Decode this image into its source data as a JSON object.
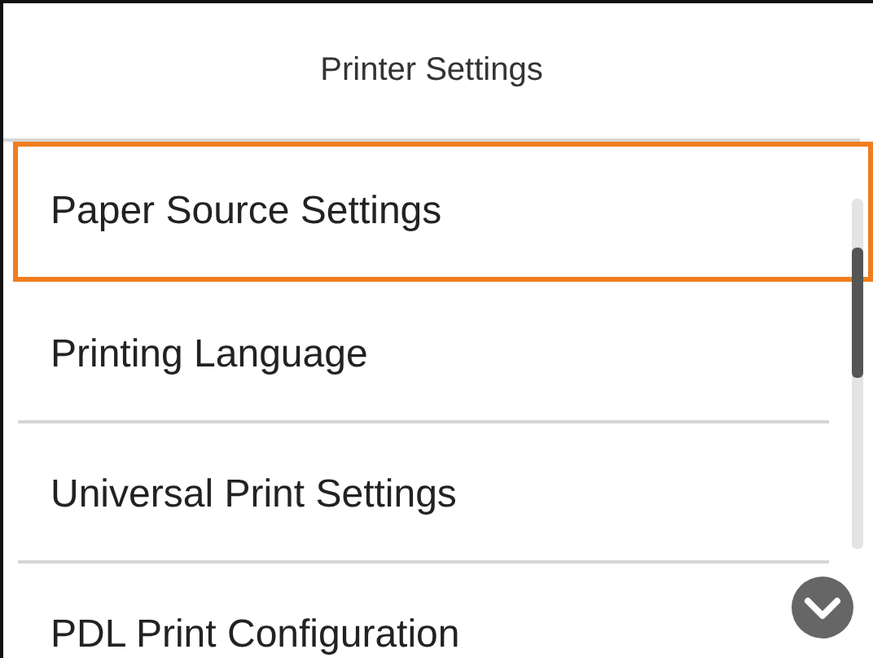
{
  "header": {
    "title": "Printer Settings"
  },
  "items": [
    {
      "label": "Paper Source Settings",
      "selected": true
    },
    {
      "label": "Printing Language",
      "selected": false
    },
    {
      "label": "Universal Print Settings",
      "selected": false
    },
    {
      "label": "PDL Print Configuration",
      "selected": false
    }
  ]
}
